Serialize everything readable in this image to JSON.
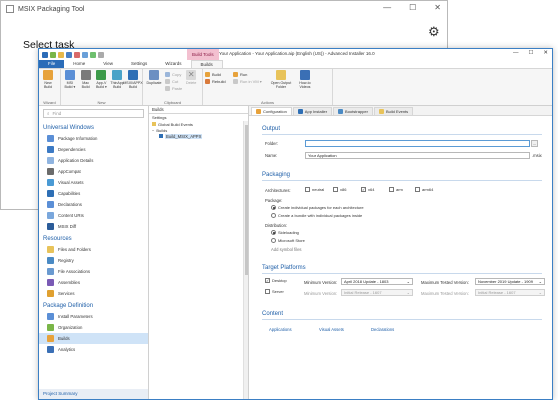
{
  "msix": {
    "title": "MSIX Packaging Tool",
    "heading": "Select task"
  },
  "ai": {
    "title": "Your Application - Your Application.aip (English (US)) - Advanced Installer 16.0",
    "build_tools": "Build Tools",
    "tabs": [
      "File",
      "Home",
      "View",
      "Settings",
      "Wizards",
      "Builds"
    ],
    "ribbon": {
      "wizard": {
        "label": "Wizard",
        "buttons": [
          "New Build"
        ]
      },
      "new": {
        "label": "New",
        "buttons": [
          "MSI Build ▾",
          "Mac Build",
          "App-V Build ▾",
          "ThinApp Build",
          "MSIX/APPX Build"
        ]
      },
      "clipboard": {
        "label": "Clipboard",
        "big": "Duplicate",
        "small": [
          "Copy",
          "Cut",
          "Paste"
        ],
        "delete": "Delete"
      },
      "actions": {
        "label": "Actions",
        "small_left": [
          "Build",
          "Rebuild"
        ],
        "small_right": [
          "Run",
          "Run in VM ▾"
        ],
        "big": [
          "Open Output Folder",
          "How-to Videos"
        ]
      }
    },
    "leftnav": {
      "find_placeholder": "Find",
      "sections": [
        {
          "title": "Universal Windows",
          "items": [
            "Package Information",
            "Dependencies",
            "Application Details",
            "AppCompat",
            "Visual Assets",
            "Capabilities",
            "Declarations",
            "Content URIs",
            "MSIX Diff"
          ]
        },
        {
          "title": "Resources",
          "items": [
            "Files and Folders",
            "Registry",
            "File Associations",
            "Assemblies",
            "Services"
          ]
        },
        {
          "title": "Package Definition",
          "items": [
            "Install Parameters",
            "Organization",
            "Builds",
            "Analytics"
          ]
        }
      ],
      "selected": "Builds",
      "project_summary": "Project Summary"
    },
    "tree": {
      "header": "Builds",
      "sub": "Settings",
      "rows": [
        "Global Build Events",
        "Builds",
        "Build_MSIX_APPX"
      ]
    },
    "main_tabs": [
      "Configuration",
      "App Installer",
      "Bootstrapper",
      "Build Events"
    ],
    "output": {
      "title": "Output",
      "folder_label": "Folder:",
      "folder_value": "",
      "name_label": "Name:",
      "name_value": "Your Application",
      "name_ext": ".msix"
    },
    "packaging": {
      "title": "Packaging",
      "arch_label": "Architectures:",
      "archs": [
        {
          "label": "neutral",
          "checked": false
        },
        {
          "label": "x86",
          "checked": false
        },
        {
          "label": "x64",
          "checked": true
        },
        {
          "label": "arm",
          "checked": false
        },
        {
          "label": "arm64",
          "checked": false
        }
      ],
      "package_label": "Package:",
      "package_options": [
        "Create individual packages for each architecture",
        "Create a bundle with individual packages inside"
      ],
      "distribution_label": "Distribution:",
      "distribution_options": [
        "Sideloading",
        "Microsoft Store"
      ],
      "add_symbol_files": "Add symbol files"
    },
    "platforms": {
      "title": "Target Platforms",
      "min_label": "Minimum Version:",
      "max_label": "Maximum Tested Version:",
      "rows": [
        {
          "name": "Desktop",
          "checked": true,
          "min": "April 2018 Update - 1803",
          "max": "November 2019 Update - 1909",
          "enabled": true
        },
        {
          "name": "Server",
          "checked": false,
          "min": "Initial Release - 1607",
          "max": "Initial Release - 1607",
          "enabled": false
        }
      ]
    },
    "content": {
      "title": "Content",
      "links": [
        "Applications",
        "Visual Assets",
        "Declarations"
      ]
    }
  }
}
